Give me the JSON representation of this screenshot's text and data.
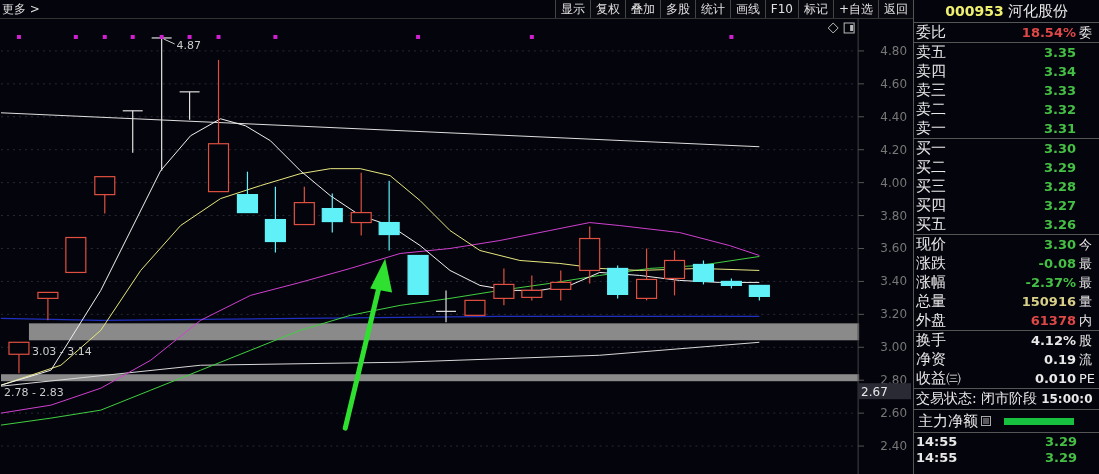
{
  "toolbar": {
    "more": "更多 >",
    "buttons": [
      "显示",
      "复权",
      "叠加",
      "多股",
      "统计",
      "画线",
      "F10",
      "标记",
      "+自选",
      "返回"
    ]
  },
  "chart": {
    "high_label": "4.87",
    "band_labels": [
      "3.03 - 3.14",
      "2.78 - 2.83"
    ],
    "current_label": "2.67",
    "axis_ticks": [
      "4.80",
      "4.60",
      "4.40",
      "4.20",
      "4.00",
      "3.80",
      "3.60",
      "3.40",
      "3.20",
      "3.00",
      "2.80",
      "2.60",
      "2.40"
    ]
  },
  "quote": {
    "code": "000953",
    "name": "河化股份",
    "ratio": {
      "label": "委比",
      "value": "18.54%",
      "extra": "委"
    },
    "asks": [
      {
        "label": "卖五",
        "price": "3.35"
      },
      {
        "label": "卖四",
        "price": "3.34"
      },
      {
        "label": "卖三",
        "price": "3.33"
      },
      {
        "label": "卖二",
        "price": "3.32"
      },
      {
        "label": "卖一",
        "price": "3.31"
      }
    ],
    "bids": [
      {
        "label": "买一",
        "price": "3.30"
      },
      {
        "label": "买二",
        "price": "3.29"
      },
      {
        "label": "买三",
        "price": "3.28"
      },
      {
        "label": "买四",
        "price": "3.27"
      },
      {
        "label": "买五",
        "price": "3.26"
      }
    ],
    "stats": [
      {
        "label": "现价",
        "value": "3.30",
        "extra": "今",
        "color": "#44c044"
      },
      {
        "label": "涨跌",
        "value": "-0.08",
        "extra": "最",
        "color": "#44c044"
      },
      {
        "label": "涨幅",
        "value": "-2.37%",
        "extra": "最",
        "color": "#44c044"
      },
      {
        "label": "总量",
        "value": "150916",
        "extra": "量",
        "color": "#d8d088"
      },
      {
        "label": "外盘",
        "value": "61378",
        "extra": "内",
        "color": "#e04848"
      }
    ],
    "info": [
      {
        "label": "换手",
        "value": "4.12%",
        "extra": "股"
      },
      {
        "label": "净资",
        "value": "0.19",
        "extra": "流"
      },
      {
        "label": "收益㈢",
        "value": "0.010",
        "extra": "PE"
      }
    ],
    "status": {
      "label": "交易状态: 闭市阶段",
      "time": "15:00:0"
    },
    "main_force": {
      "label": "主力净额"
    },
    "ticks": [
      {
        "time": "14:55",
        "price": "3.29"
      },
      {
        "time": "14:55",
        "price": "3.29"
      }
    ]
  }
}
